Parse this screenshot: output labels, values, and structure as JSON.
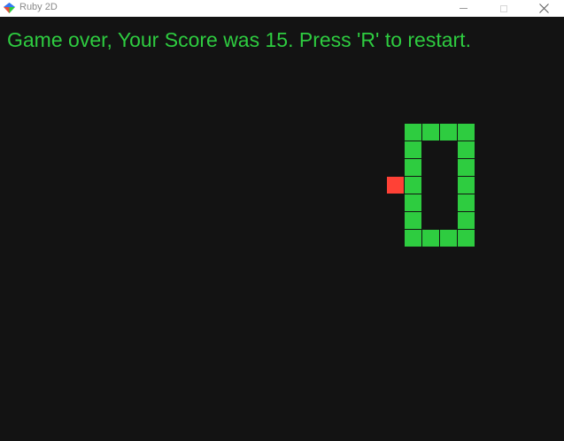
{
  "window": {
    "title": "Ruby 2D"
  },
  "colors": {
    "background": "#131313",
    "snake": "#2ecc40",
    "food": "#ff4136",
    "message": "#2ecc40"
  },
  "icons": {
    "app": "ruby2d-logo-icon",
    "minimize": "minimize-icon",
    "maximize": "maximize-icon",
    "close": "close-icon"
  },
  "game": {
    "message": "Game over, Your Score was 15. Press 'R' to restart.",
    "grid_cell_size": 20,
    "food": {
      "col": 22,
      "row": 9
    },
    "snake": [
      {
        "col": 23,
        "row": 6
      },
      {
        "col": 24,
        "row": 6
      },
      {
        "col": 25,
        "row": 6
      },
      {
        "col": 26,
        "row": 6
      },
      {
        "col": 23,
        "row": 7
      },
      {
        "col": 26,
        "row": 7
      },
      {
        "col": 23,
        "row": 8
      },
      {
        "col": 26,
        "row": 8
      },
      {
        "col": 23,
        "row": 9
      },
      {
        "col": 26,
        "row": 9
      },
      {
        "col": 23,
        "row": 10
      },
      {
        "col": 26,
        "row": 10
      },
      {
        "col": 23,
        "row": 11
      },
      {
        "col": 26,
        "row": 11
      },
      {
        "col": 23,
        "row": 12
      },
      {
        "col": 24,
        "row": 12
      },
      {
        "col": 25,
        "row": 12
      },
      {
        "col": 26,
        "row": 12
      }
    ]
  }
}
